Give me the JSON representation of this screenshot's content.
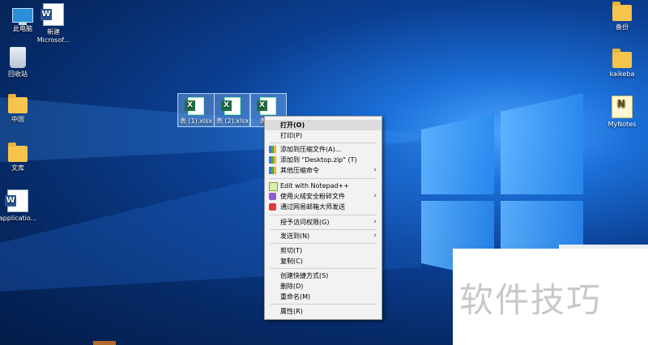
{
  "desktop": {
    "left_icons": [
      {
        "name": "this-pc",
        "label": "此电脑"
      },
      {
        "name": "new-word-doc",
        "label": "新建\nMicrosof..."
      },
      {
        "name": "recycle-bin",
        "label": "回收站"
      },
      {
        "name": "folder-zhongguo",
        "label": "中国"
      },
      {
        "name": "folder-wenku",
        "label": "文库"
      },
      {
        "name": "word-application",
        "label": "applicatio..."
      }
    ],
    "right_icons": [
      {
        "name": "folder-backup",
        "label": "备份"
      },
      {
        "name": "folder-kaikeba",
        "label": "kaikeba"
      },
      {
        "name": "mynotes",
        "label": "MyNotes"
      }
    ],
    "selected_files": [
      {
        "label": "表 (1).xlsx"
      },
      {
        "label": "表 (2).xlsx"
      },
      {
        "label": "表 (..."
      }
    ]
  },
  "context_menu": {
    "items": [
      {
        "label": "打开(O)",
        "bold": true
      },
      {
        "label": "打印(P)"
      },
      {
        "label": "添加到压缩文件(A)...",
        "icon": "archive-icon"
      },
      {
        "label": "添加到 \"Desktop.zip\" (T)",
        "icon": "archive-icon"
      },
      {
        "label": "其他压缩命令",
        "icon": "archive-icon",
        "submenu": true
      },
      {
        "label": "Edit with Notepad++",
        "icon": "notepad-icon"
      },
      {
        "label": "使用火绒安全粉碎文件",
        "icon": "shredder-icon",
        "submenu": true
      },
      {
        "label": "通过网易邮箱大师发送",
        "icon": "mail-icon"
      },
      {
        "label": "授予访问权限(G)",
        "submenu": true
      },
      {
        "label": "发送到(N)",
        "submenu": true
      },
      {
        "label": "剪切(T)"
      },
      {
        "label": "复制(C)"
      },
      {
        "label": "创建快捷方式(S)"
      },
      {
        "label": "删除(D)"
      },
      {
        "label": "重命名(M)"
      },
      {
        "label": "属性(R)"
      }
    ]
  },
  "watermark": {
    "text": "软件技巧"
  },
  "colors": {
    "accent": "#1b6fd8",
    "menu_bg": "#f2f2f2",
    "excel_green": "#1e7145"
  }
}
